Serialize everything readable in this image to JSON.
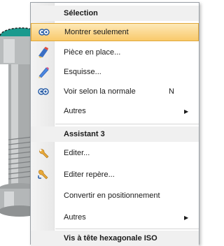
{
  "menu": {
    "section1_header": "Sélection",
    "items1": [
      {
        "label": "Montrer seulement",
        "icon": "show-only-icon",
        "highlighted": true
      },
      {
        "label": "Pièce en place...",
        "icon": "part-in-place-icon"
      },
      {
        "label": "Esquisse...",
        "icon": "sketch-pencil-icon"
      },
      {
        "label": "Voir selon la normale",
        "icon": "view-normal-icon",
        "shortcut": "N"
      },
      {
        "label": "Autres",
        "submenu": true
      }
    ],
    "section2_header": "Assistant 3",
    "items2": [
      {
        "label": "Editer...",
        "icon": "wrench-edit-icon"
      },
      {
        "label": "Editer repère...",
        "icon": "edit-frame-icon"
      },
      {
        "label": "Convertir en positionnement"
      },
      {
        "label": "Autres",
        "submenu": true
      }
    ],
    "section3_header": "Vis à tête hexagonale ISO"
  },
  "colors": {
    "highlight": "#f9c96b",
    "highlight_border": "#e0a83a",
    "part_face": "#1a9a8e"
  }
}
